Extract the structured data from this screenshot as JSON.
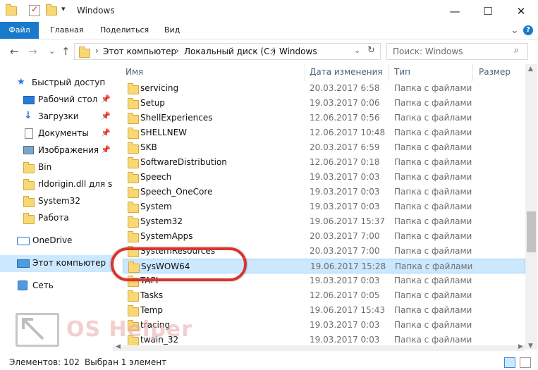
{
  "window": {
    "title": "Windows",
    "min_glyph": "—",
    "max_glyph": "☐",
    "close_glyph": "✕"
  },
  "ribbon": {
    "tabs": [
      "Файл",
      "Главная",
      "Поделиться",
      "Вид"
    ],
    "expand_glyph": "⌄",
    "help_glyph": "?"
  },
  "nav": {
    "back_glyph": "←",
    "forward_glyph": "→",
    "recent_glyph": "⌄",
    "up_glyph": "↑",
    "breadcrumb": [
      "Этот компьютер",
      "Локальный диск (C:)",
      "Windows"
    ],
    "search_placeholder": "Поиск: Windows"
  },
  "sidebar": {
    "quick_access": "Быстрый доступ",
    "items": [
      {
        "label": "Рабочий стол",
        "icon": "desktop-icon",
        "pinned": true
      },
      {
        "label": "Загрузки",
        "icon": "download-icon",
        "pinned": true
      },
      {
        "label": "Документы",
        "icon": "document-icon",
        "pinned": true
      },
      {
        "label": "Изображения",
        "icon": "image-icon",
        "pinned": true
      },
      {
        "label": "Bin",
        "icon": "folder-icon",
        "pinned": false
      },
      {
        "label": "rldorigin.dll для sims",
        "icon": "folder-icon",
        "pinned": false
      },
      {
        "label": "System32",
        "icon": "folder-icon",
        "pinned": false
      },
      {
        "label": "Работа",
        "icon": "folder-icon",
        "pinned": false
      }
    ],
    "onedrive": "OneDrive",
    "this_pc": "Этот компьютер",
    "network": "Сеть"
  },
  "columns": {
    "name": "Имя",
    "date": "Дата изменения",
    "type": "Тип",
    "size": "Размер"
  },
  "files": [
    {
      "name": "servicing",
      "date": "20.03.2017 6:58",
      "type": "Папка с файлами"
    },
    {
      "name": "Setup",
      "date": "19.03.2017 0:06",
      "type": "Папка с файлами"
    },
    {
      "name": "ShellExperiences",
      "date": "12.06.2017 0:56",
      "type": "Папка с файлами"
    },
    {
      "name": "SHELLNEW",
      "date": "12.06.2017 10:48",
      "type": "Папка с файлами"
    },
    {
      "name": "SKB",
      "date": "20.03.2017 6:59",
      "type": "Папка с файлами"
    },
    {
      "name": "SoftwareDistribution",
      "date": "12.06.2017 0:18",
      "type": "Папка с файлами"
    },
    {
      "name": "Speech",
      "date": "19.03.2017 0:03",
      "type": "Папка с файлами"
    },
    {
      "name": "Speech_OneCore",
      "date": "19.03.2017 0:03",
      "type": "Папка с файлами"
    },
    {
      "name": "System",
      "date": "19.03.2017 0:03",
      "type": "Папка с файлами"
    },
    {
      "name": "System32",
      "date": "19.06.2017 15:37",
      "type": "Папка с файлами"
    },
    {
      "name": "SystemApps",
      "date": "20.03.2017 7:00",
      "type": "Папка с файлами"
    },
    {
      "name": "SystemResources",
      "date": "20.03.2017 7:00",
      "type": "Папка с файлами"
    },
    {
      "name": "SysWOW64",
      "date": "19.06.2017 15:28",
      "type": "Папка с файлами",
      "selected": true
    },
    {
      "name": "TAPI",
      "date": "19.03.2017 0:03",
      "type": "Папка с файлами"
    },
    {
      "name": "Tasks",
      "date": "12.06.2017 0:05",
      "type": "Папка с файлами"
    },
    {
      "name": "Temp",
      "date": "19.06.2017 15:43",
      "type": "Папка с файлами"
    },
    {
      "name": "tracing",
      "date": "19.03.2017 0:03",
      "type": "Папка с файлами"
    },
    {
      "name": "twain_32",
      "date": "19.03.2017 0:03",
      "type": "Папка с файлами"
    }
  ],
  "status": {
    "count": "Элементов: 102",
    "selected": "Выбран 1 элемент"
  },
  "watermark": {
    "text": "OS Helper"
  },
  "colors": {
    "accent": "#1979ca",
    "selection": "#cce8ff",
    "highlight_ring": "#d9342e"
  }
}
